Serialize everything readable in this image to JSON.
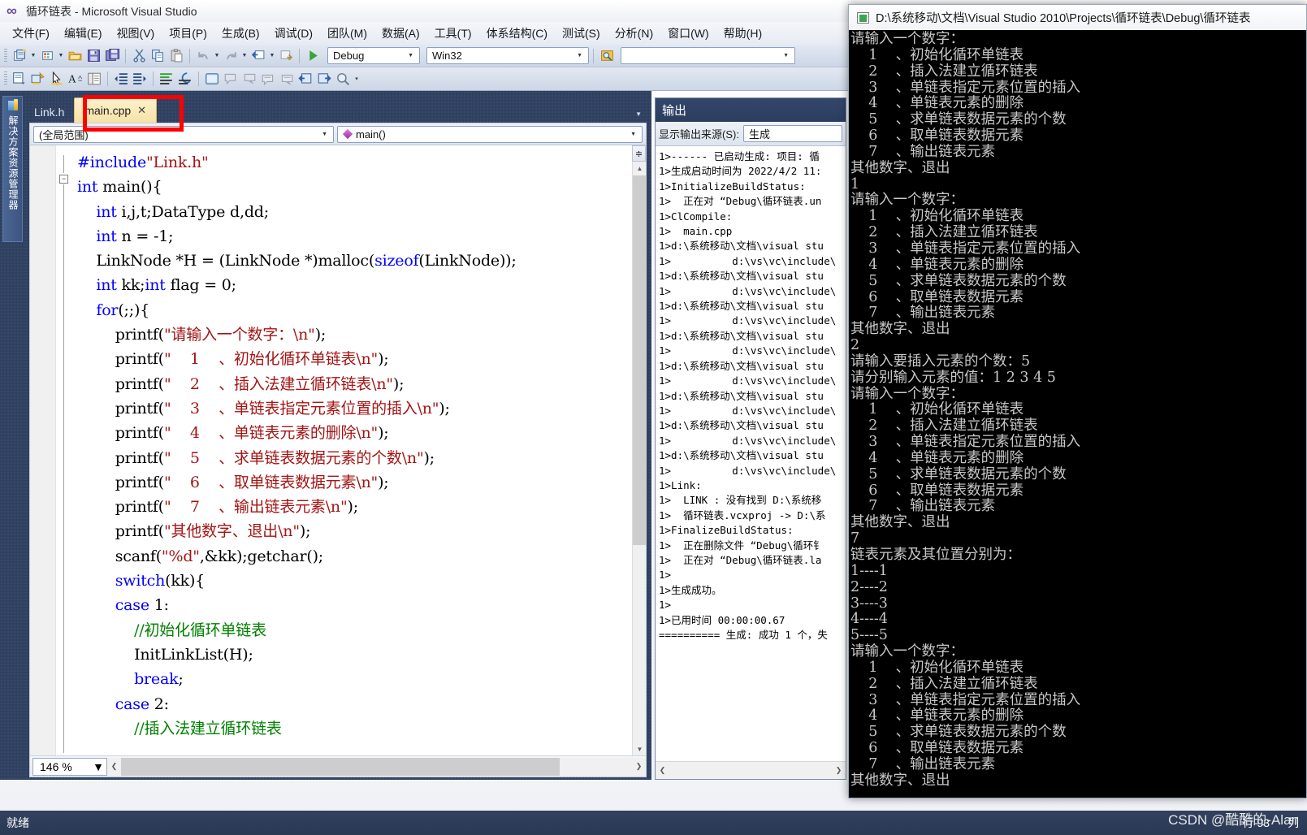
{
  "window": {
    "title": "循环链表 - Microsoft Visual Studio",
    "app_icon": "visual-studio-icon"
  },
  "menubar": {
    "items": [
      {
        "label": "文件(F)"
      },
      {
        "label": "编辑(E)"
      },
      {
        "label": "视图(V)"
      },
      {
        "label": "项目(P)"
      },
      {
        "label": "生成(B)"
      },
      {
        "label": "调试(D)"
      },
      {
        "label": "团队(M)"
      },
      {
        "label": "数据(A)"
      },
      {
        "label": "工具(T)"
      },
      {
        "label": "体系结构(C)"
      },
      {
        "label": "测试(S)"
      },
      {
        "label": "分析(N)"
      },
      {
        "label": "窗口(W)"
      },
      {
        "label": "帮助(H)"
      }
    ]
  },
  "toolbar": {
    "config_combo_value": "Debug",
    "platform_combo_value": "Win32",
    "search_combo_value": "",
    "run_icon": "start-debug-icon",
    "icons_row1": [
      "new-project-icon",
      "new-item-icon",
      "open-file-icon",
      "save-icon",
      "save-all-icon",
      "cut-icon",
      "copy-icon",
      "paste-icon",
      "undo-icon",
      "redo-icon",
      "navigate-backward-icon",
      "navigate-forward-icon"
    ],
    "icons_row2": [
      "toggle-solution-explorer-icon",
      "properties-window-icon",
      "toolbox-pointer-icon",
      "font-size-icon",
      "clipboard-ring-icon",
      "decrease-indent-icon",
      "increase-indent-icon",
      "comment-icon",
      "uncomment-icon",
      "window-icon",
      "bookmark-1-icon",
      "bookmark-2-icon",
      "bookmark-3-icon",
      "bookmark-4-icon",
      "navigate-back-icon",
      "navigate-fwd-icon",
      "find-symbol-icon"
    ]
  },
  "left_dock": {
    "solution_explorer_label": "解决方案资源管理器",
    "icon": "solution-explorer-icon"
  },
  "editor": {
    "tabs": [
      {
        "label": "Link.h",
        "active": false,
        "closable": false
      },
      {
        "label": "main.cpp",
        "active": true,
        "closable": true,
        "close_glyph": "✕"
      }
    ],
    "navbar": {
      "scope_value": "(全局范围)",
      "function_value": "main()",
      "function_icon": "method-icon"
    },
    "zoom_level": "146 %",
    "code_lines": [
      "#include\"Link.h\"",
      "int main(){",
      "    int i,j,t;DataType d,dd;",
      "    int n = -1;",
      "    LinkNode *H = (LinkNode *)malloc(sizeof(LinkNode));",
      "    int kk;int flag = 0;",
      "    for(;;){",
      "        printf(\"请输入一个数字：\\n\");",
      "        printf(\"    1    、初始化循环单链表\\n\");",
      "        printf(\"    2    、插入法建立循环链表\\n\");",
      "        printf(\"    3    、单链表指定元素位置的插入\\n\");",
      "        printf(\"    4    、单链表元素的删除\\n\");",
      "        printf(\"    5    、求单链表数据元素的个数\\n\");",
      "        printf(\"    6    、取单链表数据元素\\n\");",
      "        printf(\"    7    、输出链表元素\\n\");",
      "        printf(\"其他数字、退出\\n\");",
      "        scanf(\"%d\",&kk);getchar();",
      "        switch(kk){",
      "        case 1:",
      "            //初始化循环单链表",
      "            InitLinkList(H);",
      "            break;",
      "        case 2:",
      "            //插入法建立循环链表"
    ]
  },
  "output_panel": {
    "title": "输出",
    "source_label": "显示输出来源(S):",
    "source_value": "生成",
    "lines": [
      "1>------ 已启动生成: 项目: 循",
      "1>生成启动时间为 2022/4/2 11:",
      "1>InitializeBuildStatus:",
      "1>  正在对 “Debug\\循环链表.un",
      "1>ClCompile:",
      "1>  main.cpp",
      "1>d:\\系统移动\\文档\\visual stu",
      "1>          d:\\vs\\vc\\include\\",
      "1>d:\\系统移动\\文档\\visual stu",
      "1>          d:\\vs\\vc\\include\\",
      "1>d:\\系统移动\\文档\\visual stu",
      "1>          d:\\vs\\vc\\include\\",
      "1>d:\\系统移动\\文档\\visual stu",
      "1>          d:\\vs\\vc\\include\\",
      "1>d:\\系统移动\\文档\\visual stu",
      "1>          d:\\vs\\vc\\include\\",
      "1>d:\\系统移动\\文档\\visual stu",
      "1>          d:\\vs\\vc\\include\\",
      "1>d:\\系统移动\\文档\\visual stu",
      "1>          d:\\vs\\vc\\include\\",
      "1>d:\\系统移动\\文档\\visual stu",
      "1>          d:\\vs\\vc\\include\\",
      "1>Link:",
      "1>  LINK : 没有找到 D:\\系统移",
      "1>  循环链表.vcxproj -> D:\\系",
      "1>FinalizeBuildStatus:",
      "1>  正在删除文件 “Debug\\循环钅",
      "1>  正在对 “Debug\\循环链表.la",
      "1>",
      "1>生成成功。",
      "1>",
      "1>已用时间 00:00:00.67",
      "========== 生成: 成功 1 个，失"
    ]
  },
  "console": {
    "title": "D:\\系统移动\\文档\\Visual Studio 2010\\Projects\\循环链表\\Debug\\循环链表",
    "icon": "console-window-icon",
    "lines": [
      "请输入一个数字：",
      "    1    、初始化循环单链表",
      "    2    、插入法建立循环链表",
      "    3    、单链表指定元素位置的插入",
      "    4    、单链表元素的删除",
      "    5    、求单链表数据元素的个数",
      "    6    、取单链表数据元素",
      "    7    、输出链表元素",
      "其他数字、退出",
      "1",
      "请输入一个数字：",
      "    1    、初始化循环单链表",
      "    2    、插入法建立循环链表",
      "    3    、单链表指定元素位置的插入",
      "    4    、单链表元素的删除",
      "    5    、求单链表数据元素的个数",
      "    6    、取单链表数据元素",
      "    7    、输出链表元素",
      "其他数字、退出",
      "2",
      "请输入要插入元素的个数：5",
      "请分别输入元素的值：1 2 3 4 5",
      "请输入一个数字：",
      "    1    、初始化循环单链表",
      "    2    、插入法建立循环链表",
      "    3    、单链表指定元素位置的插入",
      "    4    、单链表元素的删除",
      "    5    、求单链表数据元素的个数",
      "    6    、取单链表数据元素",
      "    7    、输出链表元素",
      "其他数字、退出",
      "7",
      "链表元素及其位置分别为：",
      "1----1",
      "2----2",
      "3----3",
      "4----4",
      "5----5",
      "请输入一个数字：",
      "    1    、初始化循环单链表",
      "    2    、插入法建立循环链表",
      "    3    、单链表指定元素位置的插入",
      "    4    、单链表元素的删除",
      "    5    、求单链表数据元素的个数",
      "    6    、取单链表数据元素",
      "    7    、输出链表元素",
      "其他数字、退出"
    ],
    "watermark": "CSDN @酷酷的-Alan"
  },
  "statusbar": {
    "message": "就绪",
    "right_items": [
      "行 93",
      "列"
    ]
  },
  "colors": {
    "accent_blue": "#2c3d5e",
    "tab_active": "#f6e2a5",
    "annotation_red": "#ff0000",
    "keyword_blue": "#0000ff",
    "string_red": "#a31515",
    "comment_green": "#008000",
    "console_bg": "#000000"
  }
}
